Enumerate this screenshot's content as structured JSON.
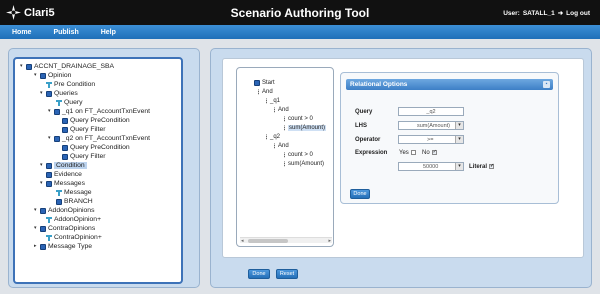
{
  "header": {
    "logo_text": "Clari5",
    "title": "Scenario Authoring Tool",
    "user_label": "User:",
    "user_name": "SATALL_1",
    "logout_label": "Log out"
  },
  "menu": {
    "items": [
      "Home",
      "Publish",
      "Help"
    ]
  },
  "tree": {
    "items": [
      {
        "label": "ACCNT_DRAINAGE_SBA",
        "icon": "blue-node-icon"
      },
      {
        "label": "Opinion",
        "icon": "blue-node-icon"
      },
      {
        "label": "Pre Condition",
        "icon": "tee-node-icon"
      },
      {
        "label": "Queries",
        "icon": "blue-node-icon"
      },
      {
        "label": "Query",
        "icon": "tee-node-icon"
      },
      {
        "label": "_q1 on FT_AccountTxnEvent",
        "icon": "blue-node-icon"
      },
      {
        "label": "Query PreCondition",
        "icon": "blue-node-icon"
      },
      {
        "label": "Query Filter",
        "icon": "blue-node-icon"
      },
      {
        "label": "_q2 on FT_AccountTxnEvent",
        "icon": "blue-node-icon"
      },
      {
        "label": "Query PreCondition",
        "icon": "blue-node-icon"
      },
      {
        "label": "Query Filter",
        "icon": "blue-node-icon"
      },
      {
        "label": "Condition",
        "icon": "blue-node-icon"
      },
      {
        "label": "Evidence",
        "icon": "blue-node-icon"
      },
      {
        "label": "Messages",
        "icon": "blue-node-icon"
      },
      {
        "label": "Message",
        "icon": "tee-node-icon"
      },
      {
        "label": "BRANCH",
        "icon": "blue-node-icon"
      },
      {
        "label": "AddonOpinions",
        "icon": "blue-node-icon"
      },
      {
        "label": "AddonOpinion+",
        "icon": "tee-node-icon"
      },
      {
        "label": "ContraOpinions",
        "icon": "blue-node-icon"
      },
      {
        "label": "ContraOpinion+",
        "icon": "tee-node-icon"
      },
      {
        "label": "Message Type",
        "icon": "blue-node-icon"
      }
    ]
  },
  "cond_tree": {
    "items": [
      "Start",
      "And",
      "_q1",
      "And",
      "count > 0",
      "sum(Amount)",
      "_q2",
      "And",
      "count > 0",
      "sum(Amount)"
    ]
  },
  "relational": {
    "title": "Relational Options",
    "query_label": "Query",
    "query_value": "_q2",
    "lhs_label": "LHS",
    "lhs_value": "sum(Amount)",
    "operator_label": "Operator",
    "operator_value": ">=",
    "expression_label": "Expression",
    "yes_label": "Yes",
    "no_label": "No",
    "rhs_value": "50000",
    "literal_label": "Literal",
    "done_label": "Done"
  },
  "footer": {
    "done_label": "Done",
    "reset_label": "Reset"
  },
  "colors": {
    "topbar": "#111111",
    "menubar": "#2a7fc9",
    "panel": "#c9dbee",
    "accent": "#3d72b8"
  }
}
